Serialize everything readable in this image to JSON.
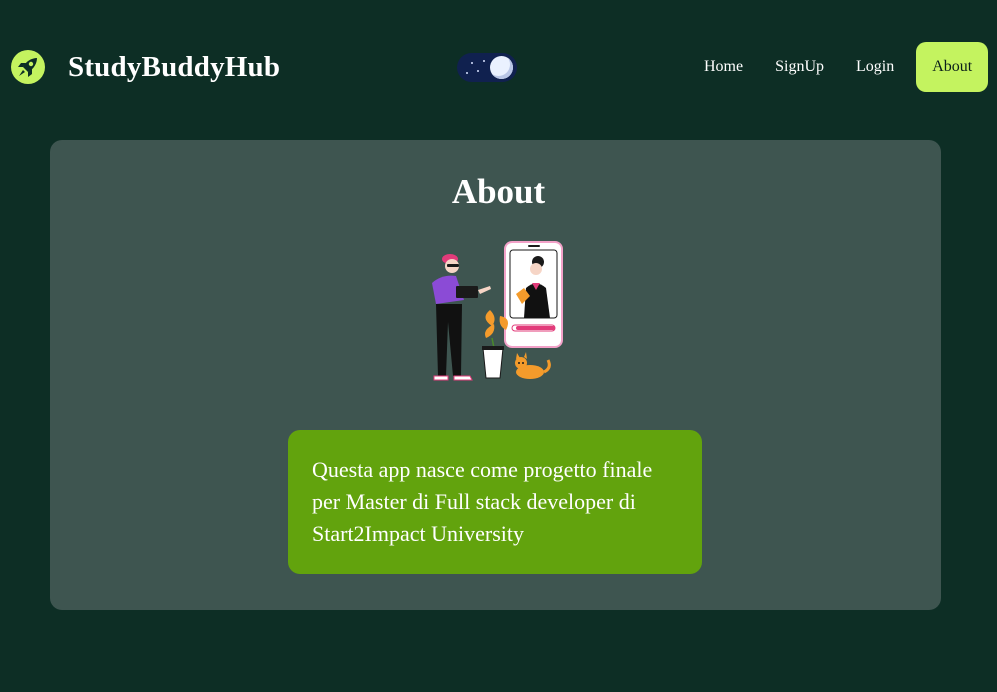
{
  "app": {
    "brand_name": "StudyBuddyHub",
    "brand_icon": "rocket-icon"
  },
  "theme_toggle": {
    "state": "dark",
    "icon": "moon-icon"
  },
  "nav": {
    "items": [
      {
        "label": "Home",
        "active": false
      },
      {
        "label": "SignUp",
        "active": false
      },
      {
        "label": "Login",
        "active": false
      },
      {
        "label": "About",
        "active": true
      }
    ]
  },
  "about": {
    "title": "About",
    "illustration": "video-call-illustration",
    "description": "Questa app nasce come progetto finale per Master di Full stack developer di Start2Impact University"
  },
  "colors": {
    "background": "#0d2e25",
    "card": "#3e5550",
    "accent": "#c4f35f",
    "info_box": "#62a30d",
    "toggle": "#10214f"
  }
}
